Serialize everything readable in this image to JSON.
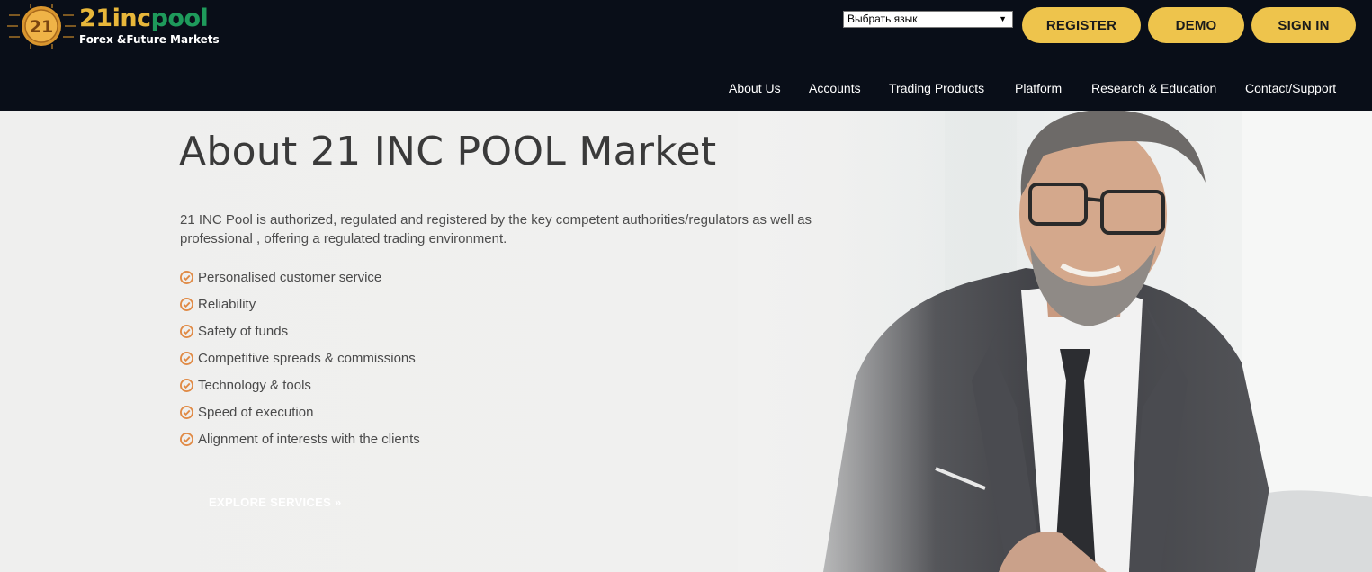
{
  "header": {
    "logo": {
      "name_part1": "21inc",
      "name_part2": "pool",
      "tagline": "Forex &Future Markets",
      "coin_text": "21"
    },
    "language_select": {
      "selected": "Выбрать язык"
    },
    "buttons": {
      "register": "REGISTER",
      "demo": "DEMO",
      "signin": "SIGN IN"
    },
    "nav": [
      {
        "label": "About Us"
      },
      {
        "label": "Accounts"
      },
      {
        "label": "Trading Products"
      },
      {
        "label": "Platform"
      },
      {
        "label": "Research & Education"
      },
      {
        "label": "Contact/Support"
      }
    ]
  },
  "hero": {
    "title": "About 21 INC POOL Market",
    "intro": "21 INC Pool is authorized, regulated and registered by the key competent authorities/regulators as well as professional , offering a regulated trading environment.",
    "features": [
      "Personalised customer service",
      "Reliability",
      "Safety of funds",
      "Competitive spreads & commissions",
      "Technology & tools",
      "Speed of execution",
      "Alignment of interests with the clients"
    ],
    "cta": "EXPLORE SERVICES »"
  },
  "colors": {
    "header_bg": "#090e18",
    "accent_gold": "#eec44c",
    "logo_green": "#1e9a5b",
    "check_orange": "#e08a45"
  }
}
